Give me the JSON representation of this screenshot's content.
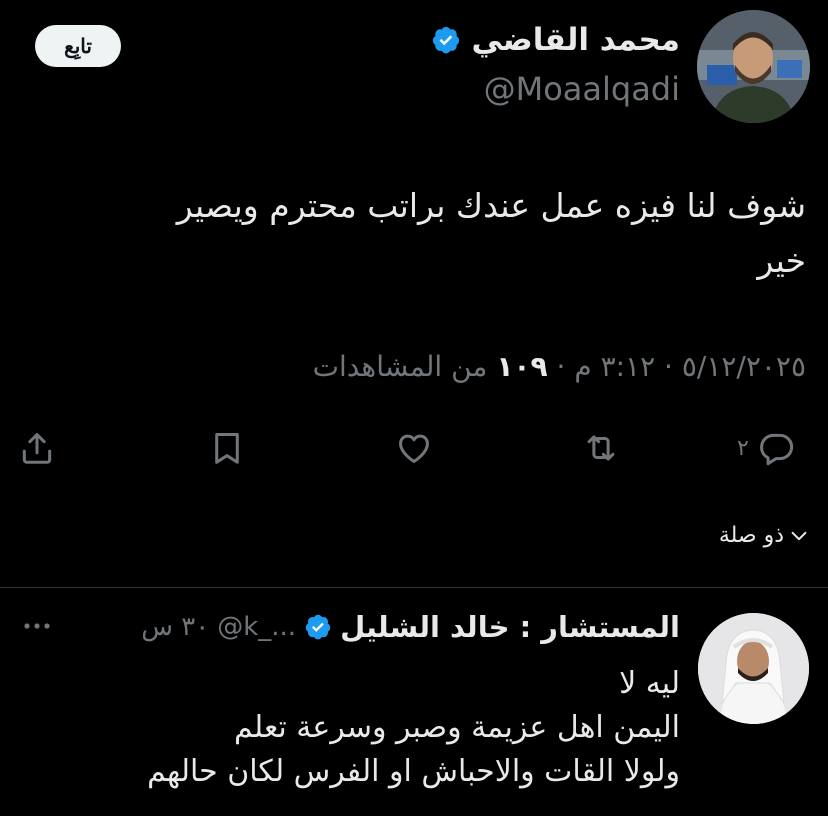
{
  "tweet": {
    "author_name": "محمد القاضي",
    "author_handle": "@Moaalqadi",
    "follow_label": "تابِع",
    "text_line1": "شوف لنا فيزه عمل عندك براتب محترم ويصير",
    "text_line2": "خير",
    "date": "٥/١٢/٢٠٢٥",
    "time": "٣:١٢ م",
    "views_count": "١٠٩",
    "views_label": "من المشاهدات",
    "reply_count": "٢"
  },
  "related_label": "ذو صلة",
  "reply": {
    "author_name": "المستشار : خالد الشليل",
    "author_handle": "@k_...",
    "time": "٣٠ س",
    "lines": [
      "ليه لا",
      "اليمن اهل عزيمة وصبر وسرعة تعلم",
      "ولولا القات والاحباش او الفرس لكان حالهم"
    ]
  },
  "colors": {
    "background": "#000000",
    "text_primary": "#e7e9ea",
    "text_secondary": "#71767b",
    "verified_blue": "#1d9bf0",
    "divider": "#2f3336"
  }
}
